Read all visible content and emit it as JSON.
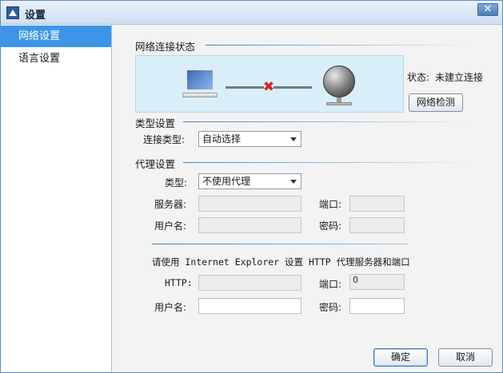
{
  "window": {
    "title": "设置",
    "close_glyph": "✕",
    "app_icon": "app-logo-icon"
  },
  "sidebar": {
    "items": [
      {
        "label": "网络设置",
        "active": true
      },
      {
        "label": "语言设置",
        "active": false
      }
    ]
  },
  "network_status": {
    "title": "网络连接状态",
    "status_label": "状态:",
    "status_value": "未建立连接",
    "check_button": "网络检测",
    "icons": [
      "laptop-icon",
      "disconnected-x-icon",
      "globe-server-icon"
    ],
    "error_color": "#d8261f"
  },
  "connection_type": {
    "title": "类型设置",
    "label": "连接类型:",
    "selected": "自动选择"
  },
  "proxy": {
    "title": "代理设置",
    "type_label": "类型:",
    "type_selected": "不使用代理",
    "server_label": "服务器:",
    "server_value": "",
    "port_label": "端口:",
    "port_value": "",
    "username_label": "用户名:",
    "username_value": "",
    "password_label": "密码:",
    "password_value": ""
  },
  "ie_proxy": {
    "note": "请使用 Internet Explorer 设置 HTTP 代理服务器和端口",
    "http_label": "HTTP:",
    "http_value": "",
    "port_label": "端口:",
    "port_value": "0",
    "username_label": "用户名:",
    "username_value": "",
    "password_label": "密码:",
    "password_value": ""
  },
  "footer": {
    "ok_button": "确定",
    "cancel_button": "取消"
  },
  "colors": {
    "accent": "#3d95e8",
    "section_line": "#3b84c4",
    "status_box": "#d8eef8"
  }
}
